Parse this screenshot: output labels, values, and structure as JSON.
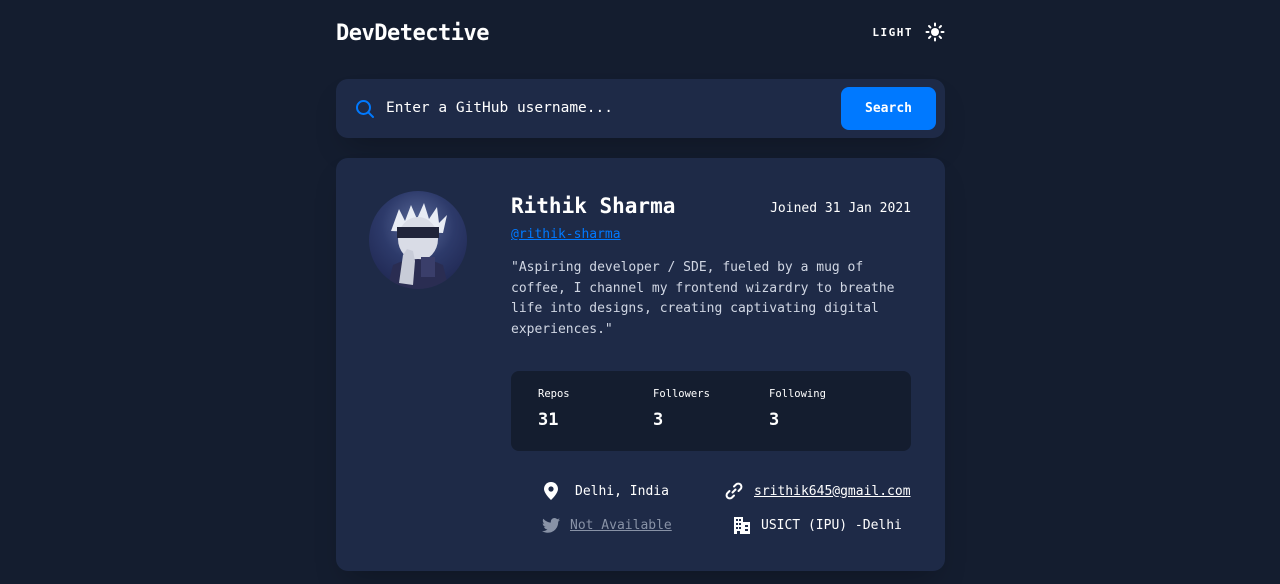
{
  "header": {
    "logo": "DevDetective",
    "mode_label": "LIGHT",
    "mode_icon": "sun-icon"
  },
  "search": {
    "placeholder": "Enter a GitHub username...",
    "button_label": "Search",
    "icon": "search-icon"
  },
  "profile": {
    "name": "Rithik Sharma",
    "joined": "Joined 31 Jan 2021",
    "handle": "@rithik-sharma",
    "bio": "\"Aspiring developer / SDE, fueled by a mug of coffee, I channel my frontend wizardry to breathe life into designs, creating captivating digital experiences.\"",
    "stats": {
      "repos_label": "Repos",
      "repos_value": "31",
      "followers_label": "Followers",
      "followers_value": "3",
      "following_label": "Following",
      "following_value": "3"
    },
    "info": {
      "location": "Delhi, India",
      "website": "srithik645@gmail.com",
      "twitter": "Not Available",
      "company": "USICT (IPU) -Delhi"
    }
  },
  "colors": {
    "background": "#141d2f",
    "card": "#1e2a47",
    "accent": "#0079ff",
    "muted": "#8892a6"
  }
}
